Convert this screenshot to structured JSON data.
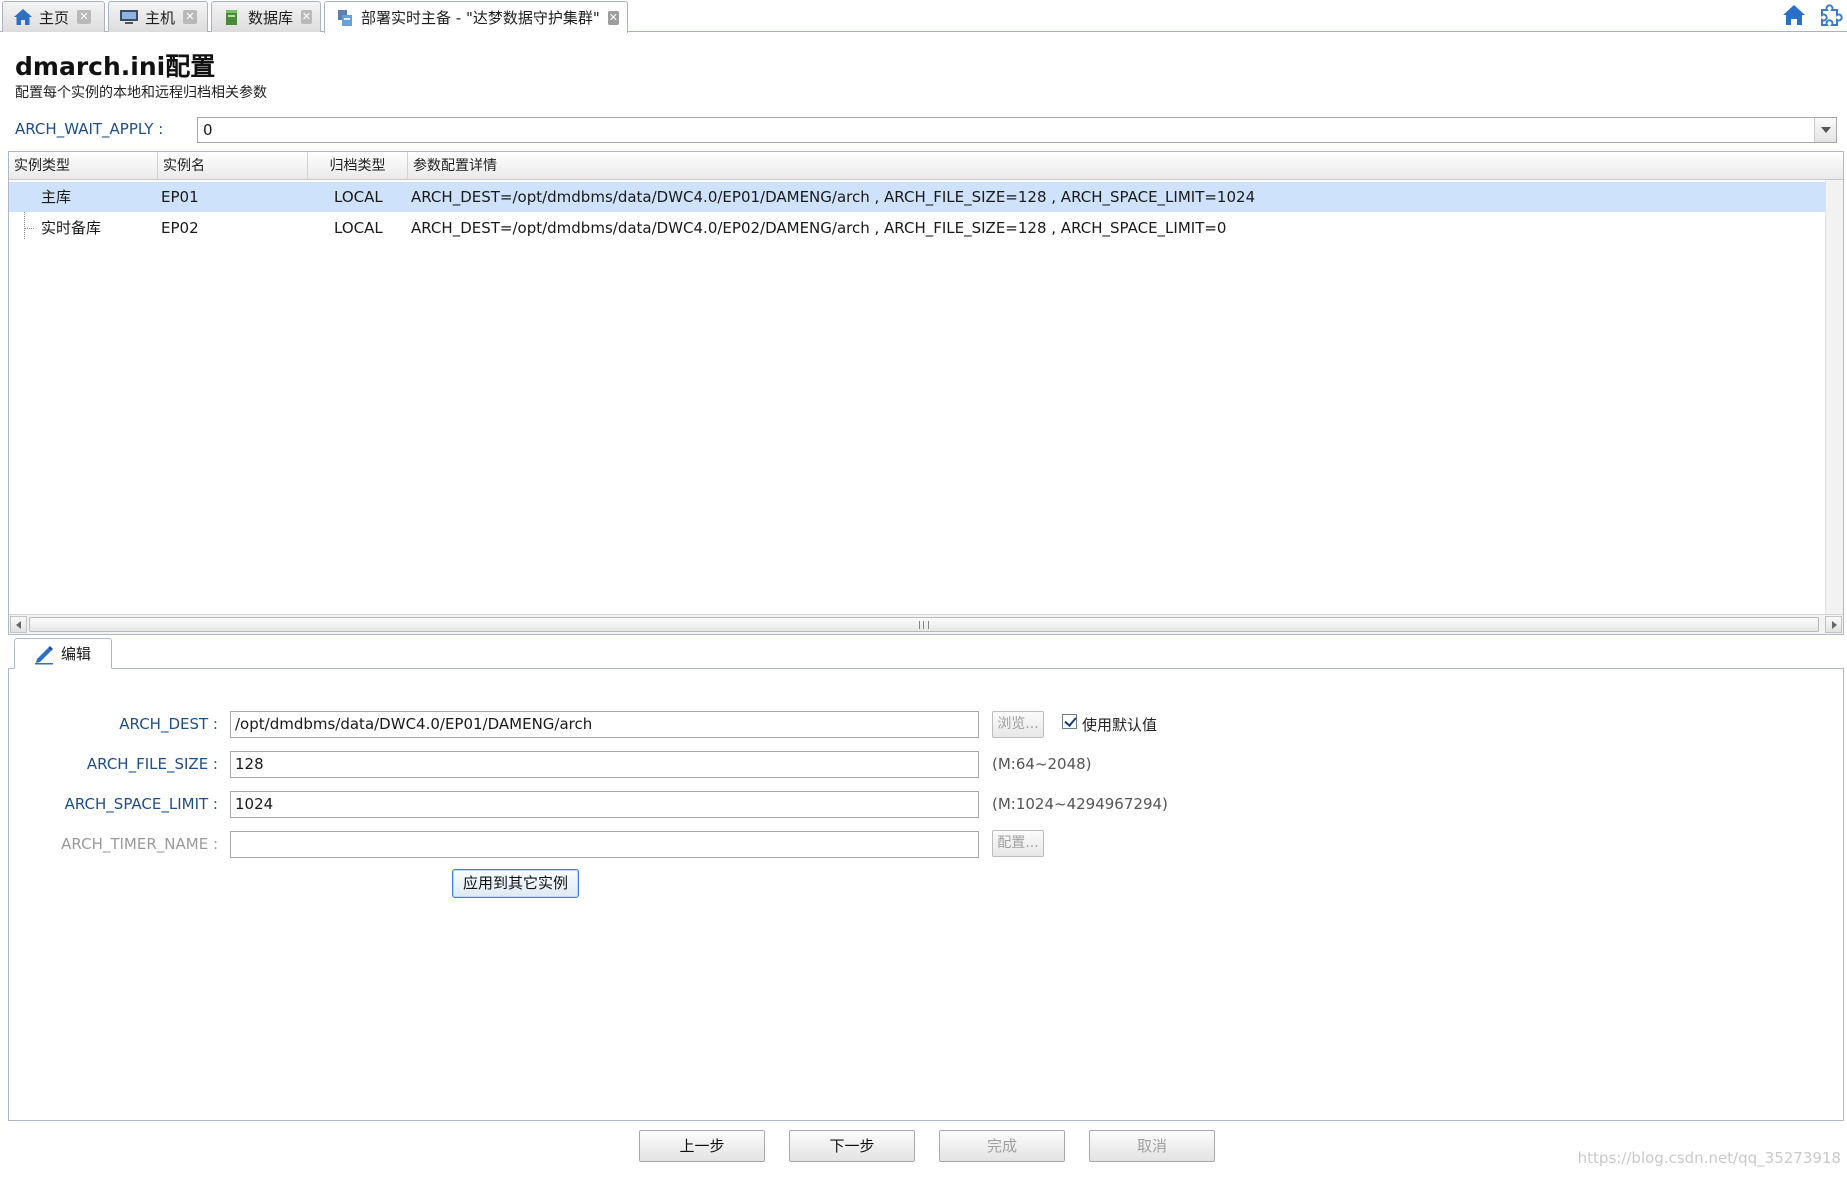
{
  "tabs": [
    {
      "label": "主页",
      "icon": "home-icon",
      "active": false
    },
    {
      "label": "主机",
      "icon": "host-icon",
      "active": false
    },
    {
      "label": "数据库",
      "icon": "database-icon",
      "active": false
    },
    {
      "label": "部署实时主备 - \"达梦数据守护集群\"",
      "icon": "deploy-icon",
      "active": true
    }
  ],
  "tab_close_glyph": "✕",
  "toolbar_icons": [
    "home-icon",
    "settings-puzzle-icon"
  ],
  "header": {
    "title": "dmarch.ini配置",
    "subtitle": "配置每个实例的本地和远程归档相关参数"
  },
  "arch_wait_apply": {
    "label": "ARCH_WAIT_APPLY :",
    "value": "0"
  },
  "grid": {
    "columns": [
      "实例类型",
      "实例名",
      "归档类型",
      "参数配置详情"
    ],
    "rows": [
      {
        "type": "主库",
        "name": "EP01",
        "arch_type": "LOCAL",
        "detail": "ARCH_DEST=/opt/dmdbms/data/DWC4.0/EP01/DAMENG/arch , ARCH_FILE_SIZE=128 , ARCH_SPACE_LIMIT=1024",
        "selected": true
      },
      {
        "type": "实时备库",
        "name": "EP02",
        "arch_type": "LOCAL",
        "detail": "ARCH_DEST=/opt/dmdbms/data/DWC4.0/EP02/DAMENG/arch , ARCH_FILE_SIZE=128 , ARCH_SPACE_LIMIT=0",
        "selected": false
      }
    ]
  },
  "edit": {
    "tab_label": "编辑",
    "fields": {
      "arch_dest": {
        "label": "ARCH_DEST :",
        "value": "/opt/dmdbms/data/DWC4.0/EP01/DAMENG/arch",
        "browse": "浏览...",
        "use_default": "使用默认值",
        "use_default_checked": true
      },
      "arch_file_size": {
        "label": "ARCH_FILE_SIZE :",
        "value": "128",
        "hint": "(M:64~2048)"
      },
      "arch_space_limit": {
        "label": "ARCH_SPACE_LIMIT :",
        "value": "1024",
        "hint": "(M:1024~4294967294)"
      },
      "arch_timer_name": {
        "label": "ARCH_TIMER_NAME :",
        "value": "",
        "config": "配置..."
      }
    },
    "apply_button": "应用到其它实例"
  },
  "footer": {
    "prev": "上一步",
    "next": "下一步",
    "finish": "完成",
    "cancel": "取消"
  },
  "watermark": "https://blog.csdn.net/qq_35273918",
  "colors": {
    "accent": "#1f4e8a",
    "selection": "#cfe2fb",
    "apply_border": "#3c7fd6"
  }
}
